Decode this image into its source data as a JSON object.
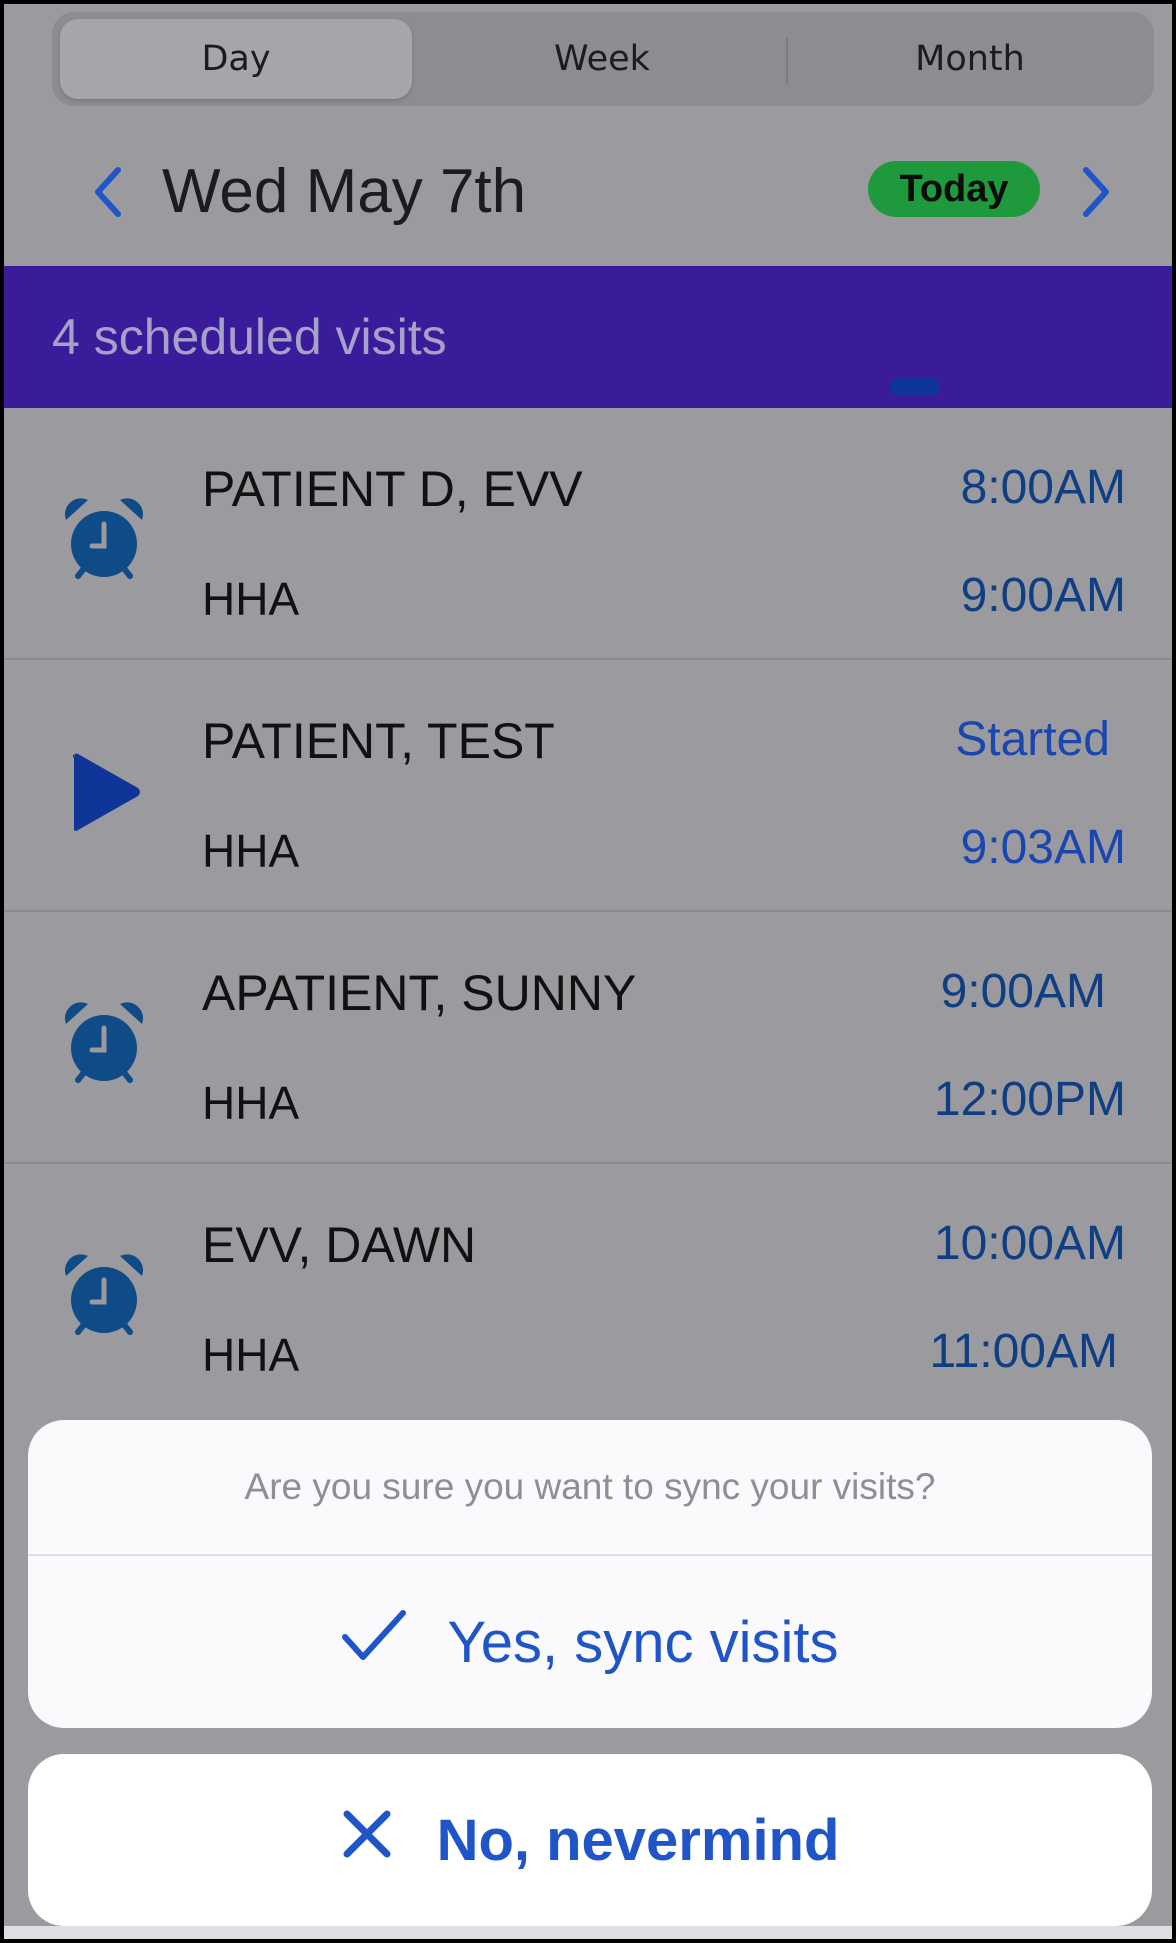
{
  "segmented": {
    "tabs": [
      {
        "label": "Day",
        "active": true
      },
      {
        "label": "Week",
        "active": false
      },
      {
        "label": "Month",
        "active": false
      }
    ]
  },
  "date_header": {
    "title": "Wed May 7th",
    "today_label": "Today",
    "prev_icon": "chevron-left-icon",
    "next_icon": "chevron-right-icon"
  },
  "banner": {
    "text": "4 scheduled visits"
  },
  "visits": [
    {
      "name": "PATIENT D, EVV",
      "type": "HHA",
      "start": "8:00AM",
      "end": "9:00AM",
      "icon": "alarm-clock-icon"
    },
    {
      "name": "PATIENT, TEST",
      "type": "HHA",
      "start": "Started",
      "end": "9:03AM",
      "icon": "play-icon"
    },
    {
      "name": "APATIENT, SUNNY",
      "type": "HHA",
      "start": "9:00AM",
      "end": "12:00PM",
      "icon": "alarm-clock-icon"
    },
    {
      "name": "EVV, DAWN",
      "type": "HHA",
      "start": "10:00AM",
      "end": "11:00AM",
      "icon": "alarm-clock-icon"
    }
  ],
  "action_sheet": {
    "message": "Are you sure you want to sync your visits?",
    "confirm_label": "Yes, sync visits",
    "cancel_label": "No, nevermind"
  },
  "colors": {
    "accent": "#1f55c9",
    "banner": "#3a1c9b",
    "today_badge": "#1e9a3c",
    "icon_blue": "#0f4b86"
  }
}
